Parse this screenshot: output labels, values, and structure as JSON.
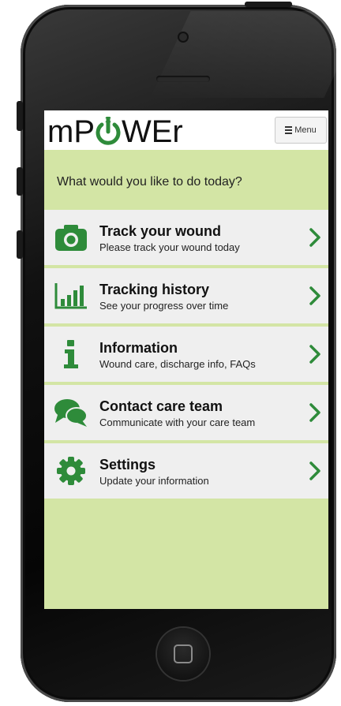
{
  "app": {
    "logo_part1": "mP",
    "logo_part2": "WEr",
    "menu_label": "Menu"
  },
  "prompt": "What would you like to do today?",
  "items": [
    {
      "title": "Track your wound",
      "subtitle": "Please track your wound today",
      "icon": "camera-icon"
    },
    {
      "title": "Tracking history",
      "subtitle": "See your progress over time",
      "icon": "bar-chart-icon"
    },
    {
      "title": "Information",
      "subtitle": "Wound care, discharge info, FAQs",
      "icon": "info-icon"
    },
    {
      "title": "Contact care team",
      "subtitle": "Communicate with your care team",
      "icon": "chat-bubbles-icon"
    },
    {
      "title": "Settings",
      "subtitle": "Update your information",
      "icon": "gear-icon"
    }
  ],
  "colors": {
    "accent_green": "#2e8b3a",
    "screen_background": "#d3e5a5",
    "item_background": "#efefef"
  }
}
